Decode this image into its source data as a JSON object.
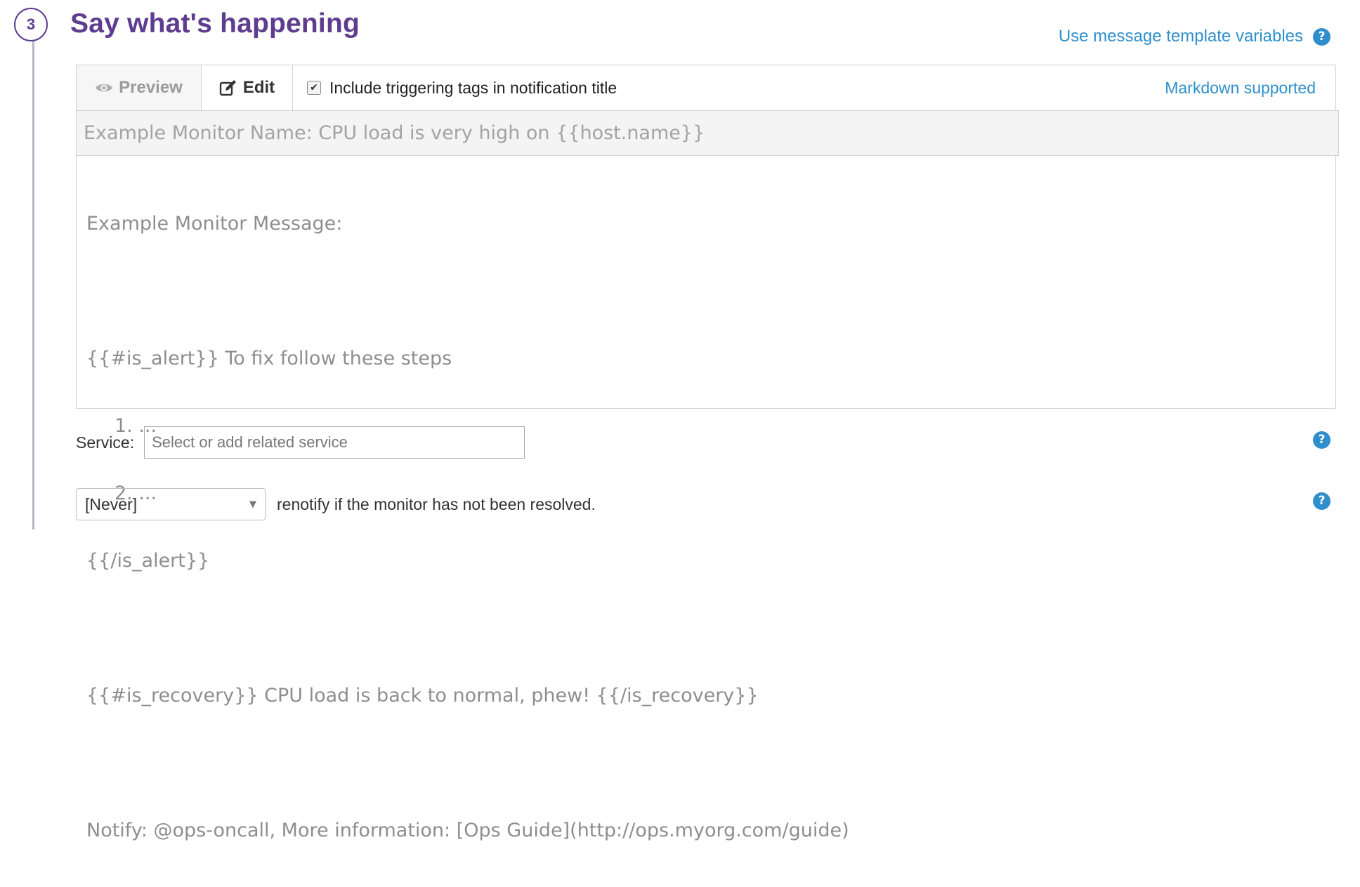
{
  "step": {
    "number": "3",
    "title": "Say what's happening"
  },
  "template_link": "Use message template variables",
  "editor": {
    "tabs": {
      "preview": "Preview",
      "edit": "Edit"
    },
    "include_tags_label": "Include triggering tags in notification title",
    "include_tags_checked": true,
    "markdown_note": "Markdown supported",
    "title_placeholder": "Example Monitor Name: CPU load is very high on {{host.name}}",
    "message_lines": [
      "Example Monitor Message:",
      "",
      "{{#is_alert}} To fix follow these steps",
      "1. ...",
      "2. ...",
      "{{/is_alert}}",
      "",
      "{{#is_recovery}} CPU load is back to normal, phew! {{/is_recovery}}",
      "",
      "Notify: @ops-oncall, More information: [Ops Guide](http://ops.myorg.com/guide)"
    ]
  },
  "service": {
    "label": "Service:",
    "placeholder": "Select or add related service"
  },
  "renotify": {
    "selected": "[Never]",
    "text": "renotify if the monitor has not been resolved."
  },
  "icons": {
    "help": "?"
  },
  "colors": {
    "accent": "#5e3c8f",
    "link": "#2f8fcc"
  }
}
